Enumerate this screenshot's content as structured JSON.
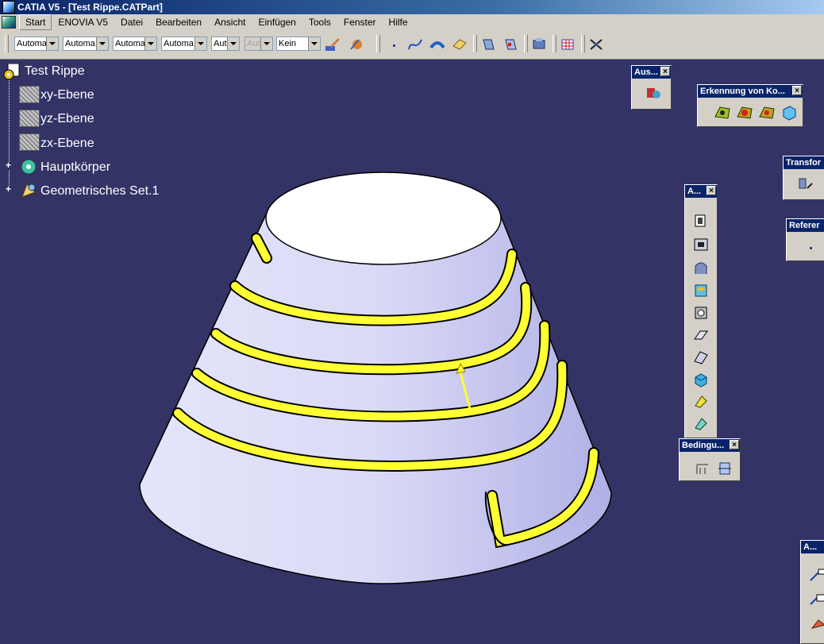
{
  "window": {
    "title": "CATIA V5 - [Test Rippe.CATPart]"
  },
  "menu": {
    "items": [
      {
        "label": "Start"
      },
      {
        "label": "ENOVIA V5"
      },
      {
        "label": "Datei"
      },
      {
        "label": "Bearbeiten"
      },
      {
        "label": "Ansicht"
      },
      {
        "label": "Einfügen"
      },
      {
        "label": "Tools"
      },
      {
        "label": "Fenster"
      },
      {
        "label": "Hilfe"
      }
    ]
  },
  "toolbar": {
    "combos": [
      {
        "value": "Automa"
      },
      {
        "value": "Automa"
      },
      {
        "value": "Automa"
      },
      {
        "value": "Automa"
      },
      {
        "value": "Aut"
      },
      {
        "value": "Aut"
      },
      {
        "value": "Kein"
      }
    ]
  },
  "tree": {
    "root": "Test Rippe",
    "items": [
      {
        "label": "xy-Ebene"
      },
      {
        "label": "yz-Ebene"
      },
      {
        "label": "zx-Ebene"
      },
      {
        "label": "Hauptkörper"
      },
      {
        "label": "Geometrisches Set.1"
      }
    ]
  },
  "floating_toolbars": {
    "aus": "Aus...",
    "erkennung": "Erkennung von Ko...",
    "transform": "Transfor",
    "a1": "A...",
    "referenz": "Referer",
    "bedingungen": "Bedingu...",
    "a2": "A..."
  },
  "colors": {
    "background": "#333366",
    "cone_surface": "#c8c8ee",
    "rib": "#ffff33"
  }
}
